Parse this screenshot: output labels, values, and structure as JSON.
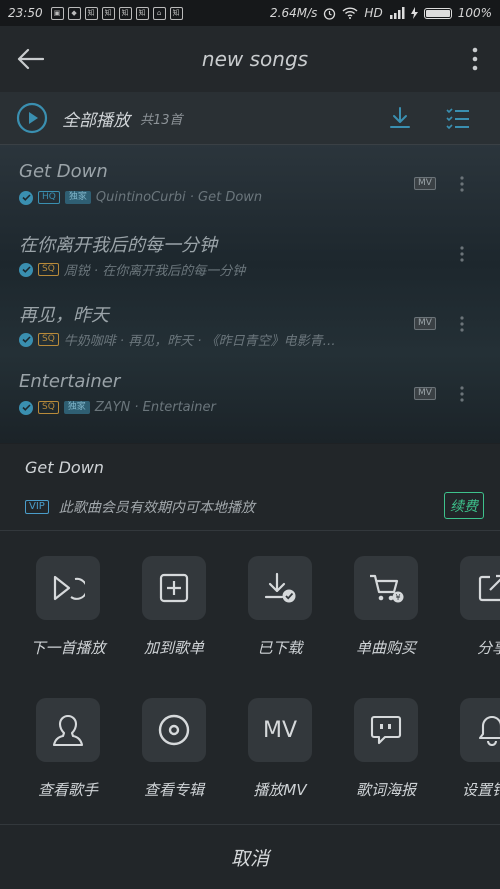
{
  "status_bar": {
    "time": "23:50",
    "notification_glyphs": [
      "▣",
      "◆",
      "知",
      "知",
      "知",
      "知",
      "⌂",
      "知"
    ],
    "network_speed": "2.64M/s",
    "network_type": "HD",
    "battery": "100%"
  },
  "top_bar": {
    "title": "new songs"
  },
  "play_all": {
    "label": "全部播放",
    "count": "共13首"
  },
  "songs": [
    {
      "name": "Get Down",
      "quality": "HQ",
      "exclusive": "独家",
      "meta": "QuintinoCurbi · Get Down",
      "mv": "MV"
    },
    {
      "name": "在你离开我后的每一分钟",
      "quality": "SQ",
      "meta": "周锐 · 在你离开我后的每一分钟"
    },
    {
      "name": "再见，昨天",
      "quality": "SQ",
      "meta": "牛奶咖啡 · 再见，昨天 · 《昨日青空》电影青…",
      "mv": "MV"
    },
    {
      "name": "Entertainer",
      "quality": "SQ",
      "exclusive": "独家",
      "meta": "ZAYN · Entertainer",
      "mv": "MV"
    }
  ],
  "panel": {
    "song_title": "Get Down",
    "vip_badge": "VIP",
    "vip_notice": "此歌曲会员有效期内可本地播放",
    "renew_label": "续费",
    "actions_row1": [
      {
        "label": "下一首播放",
        "icon": "play-next-icon"
      },
      {
        "label": "加到歌单",
        "icon": "add-to-playlist-icon"
      },
      {
        "label": "已下载",
        "icon": "downloaded-icon"
      },
      {
        "label": "单曲购买",
        "icon": "cart-icon"
      },
      {
        "label": "分享",
        "icon": "share-icon"
      }
    ],
    "actions_row2": [
      {
        "label": "查看歌手",
        "icon": "singer-icon"
      },
      {
        "label": "查看专辑",
        "icon": "album-icon"
      },
      {
        "label": "播放MV",
        "icon": "mv-icon",
        "tile_text": "MV"
      },
      {
        "label": "歌词海报",
        "icon": "lyric-poster-icon"
      },
      {
        "label": "设置铃声",
        "icon": "bell-icon"
      }
    ],
    "cancel_label": "取消"
  },
  "colors": {
    "accent_blue": "#3a8fb0",
    "renew_green": "#3ec28c",
    "sq_gold": "#b88a3a"
  }
}
